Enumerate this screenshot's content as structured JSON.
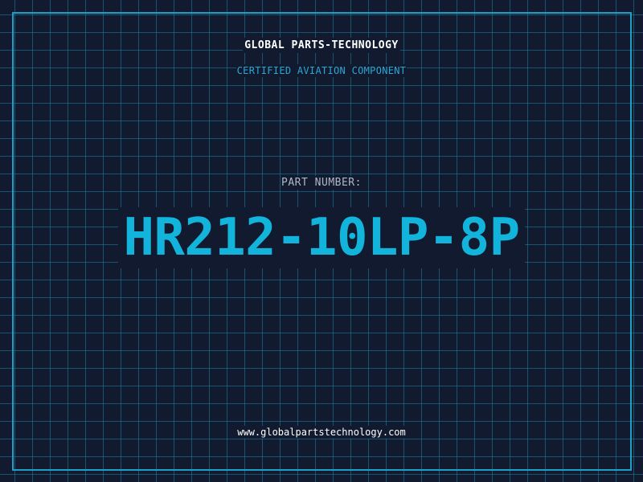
{
  "header": {
    "company_name": "GLOBAL PARTS-TECHNOLOGY",
    "subtitle": "CERTIFIED AVIATION COMPONENT"
  },
  "part": {
    "label": "PART NUMBER:",
    "number": "HR212-10LP-8P"
  },
  "footer": {
    "website": "www.globalpartstechnology.com"
  },
  "colors": {
    "background": "#111a2e",
    "grid": "#1c82a0",
    "border": "#1ea0c6",
    "accent": "#12b4dc",
    "subtitle": "#2aa8d4",
    "label": "#b0b8c4",
    "text": "#ffffff"
  }
}
